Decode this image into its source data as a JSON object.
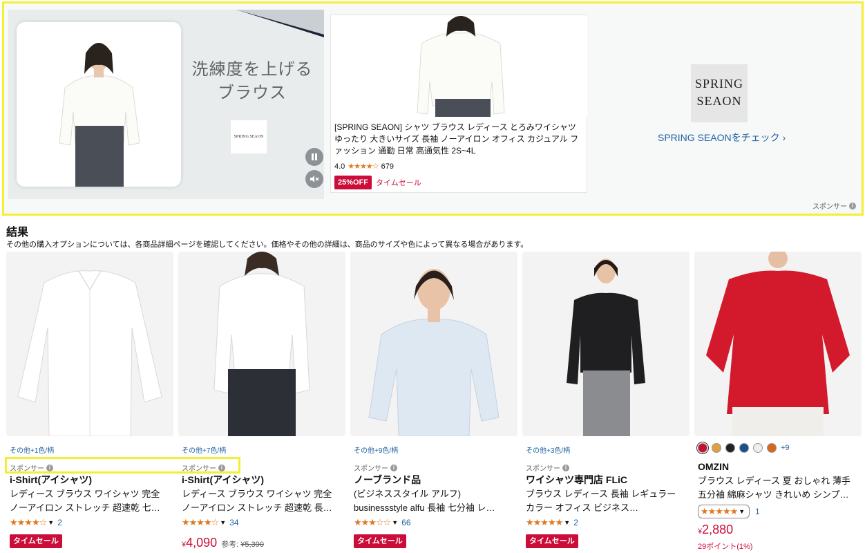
{
  "banner": {
    "video_headline_1": "洗練度を上げる",
    "video_headline_2": "ブラウス",
    "video_logo_text": "SPRING SEAON",
    "ad": {
      "title": "[SPRING SEAON] シャツ ブラウス レディース とろみワイシャツ ゆったり 大きいサイズ 長袖 ノーアイロン オフィス カジュアル ファッション 通勤 日常 高通気性 2S~4L",
      "rating": "4.0",
      "stars": "★★★★☆",
      "review_count": "679",
      "deal_badge": "25%OFF",
      "deal_text": "タイムセール"
    },
    "brand_logo_line1": "SPRING",
    "brand_logo_line2": "SEAON",
    "brand_link": "SPRING SEAONをチェック ›",
    "sponsor_label": "スポンサー"
  },
  "results": {
    "title": "結果",
    "note": "その他の購入オプションについては、各商品詳細ページを確認してください。価格やその他の詳細は、商品のサイズや色によって異なる場合があります。"
  },
  "products": [
    {
      "variants": "その他+1色/柄",
      "sponsored": "スポンサー",
      "brand": "i-Shirt(アイシャツ)",
      "title": "レディース ブラウス ワイシャツ 完全ノーアイロン ストレッチ 超速乾 七…",
      "stars": "★★★★☆",
      "count": "2",
      "deal": "タイムセール"
    },
    {
      "variants": "その他+7色/柄",
      "sponsored": "スポンサー",
      "brand": "i-Shirt(アイシャツ)",
      "title": "レディース ブラウス ワイシャツ 完全ノーアイロン ストレッチ 超速乾 長…",
      "stars": "★★★★☆",
      "count": "34",
      "price_currency": "¥",
      "price": "4,090",
      "ref_label": "参考:",
      "ref_price": "¥5,390"
    },
    {
      "variants": "その他+9色/柄",
      "sponsored": "スポンサー",
      "brand": "ノーブランド品",
      "title": "(ビジネススタイル アルフ) businessstyle alfu 長袖 七分袖 レ…",
      "stars": "★★★☆☆",
      "count": "66",
      "deal": "タイムセール"
    },
    {
      "variants": "その他+3色/柄",
      "sponsored": "スポンサー",
      "brand": "ワイシャツ専門店 FLiC",
      "title": "ブラウス レディース 長袖 レギュラーカラー オフィス ビジネス…",
      "stars": "★★★★★",
      "count": "2",
      "deal": "タイムセール"
    },
    {
      "swatch_colors": [
        "#c8102e",
        "#e0a040",
        "#222222",
        "#1c4f8c",
        "#eeeeee",
        "#d2691e"
      ],
      "more_colors": "+9",
      "brand": "OMZIN",
      "title": "ブラウス レディース 夏 おしゃれ 薄手 五分袖 綿麻シャツ きれいめ シンプ…",
      "stars": "★★★★★",
      "count": "1",
      "price_currency": "¥",
      "price": "2,880",
      "points": "29ポイント(1%)"
    }
  ]
}
